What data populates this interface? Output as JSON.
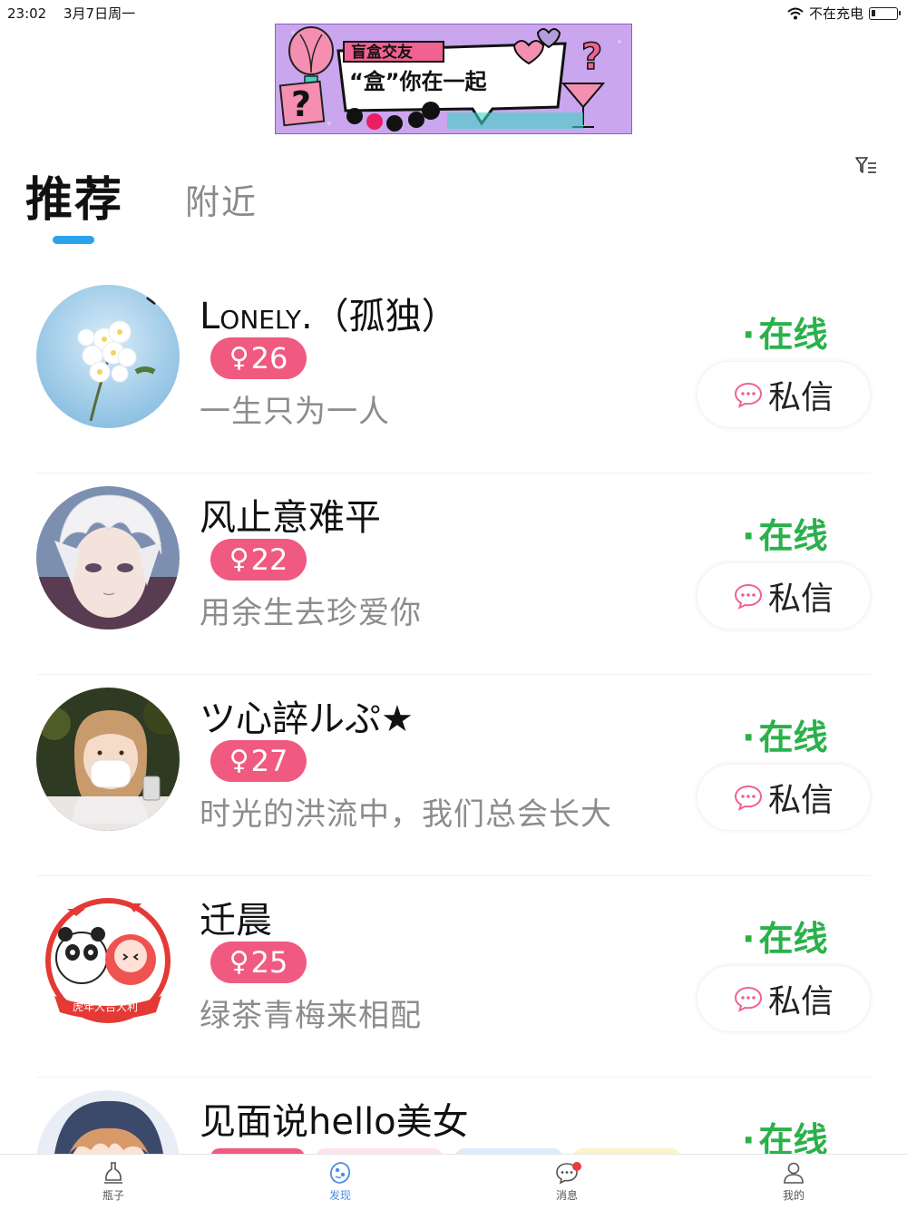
{
  "status_bar": {
    "time": "23:02",
    "date": "3月7日周一",
    "charging": "不在充电"
  },
  "banner": {
    "line1": "盲盒交友",
    "line2": "“盒”你在一起"
  },
  "tabs": [
    {
      "label": "推荐",
      "active": true
    },
    {
      "label": "附近",
      "active": false
    }
  ],
  "icons": {
    "filter": "filter-icon",
    "chat": "chat-bubble-icon",
    "wifi": "wifi-icon",
    "battery": "battery-icon"
  },
  "users": [
    {
      "name": "Lonely.（孤独）",
      "age": "26",
      "gender_symbol": "♀",
      "bio": "一生只为一人",
      "status": "在线",
      "message_label": "私信"
    },
    {
      "name": "风止意难平",
      "age": "22",
      "gender_symbol": "♀",
      "bio": "用余生去珍爱你",
      "status": "在线",
      "message_label": "私信"
    },
    {
      "name": "ツ心誶ルぷ★",
      "age": "27",
      "gender_symbol": "♀",
      "bio": "时光的洪流中，我们总会长大",
      "status": "在线",
      "message_label": "私信"
    },
    {
      "name": "迁晨",
      "age": "25",
      "gender_symbol": "♀",
      "bio": "绿茶青梅来相配",
      "status": "在线",
      "message_label": "私信",
      "avatar_text": "虎年大吉大利"
    },
    {
      "name": "见面说hello美女",
      "status": "在线"
    }
  ],
  "bottom_nav": [
    {
      "label": "瓶子",
      "icon": "bottle-icon",
      "active": false
    },
    {
      "label": "发现",
      "icon": "discover-icon",
      "active": true
    },
    {
      "label": "消息",
      "icon": "message-icon",
      "active": false,
      "badge": true
    },
    {
      "label": "我的",
      "icon": "profile-icon",
      "active": false
    }
  ],
  "colors": {
    "accent": "#2aa3ee",
    "online": "#2ab14a",
    "age_badge": "#f05a80",
    "nav_active": "#4a90e2"
  }
}
